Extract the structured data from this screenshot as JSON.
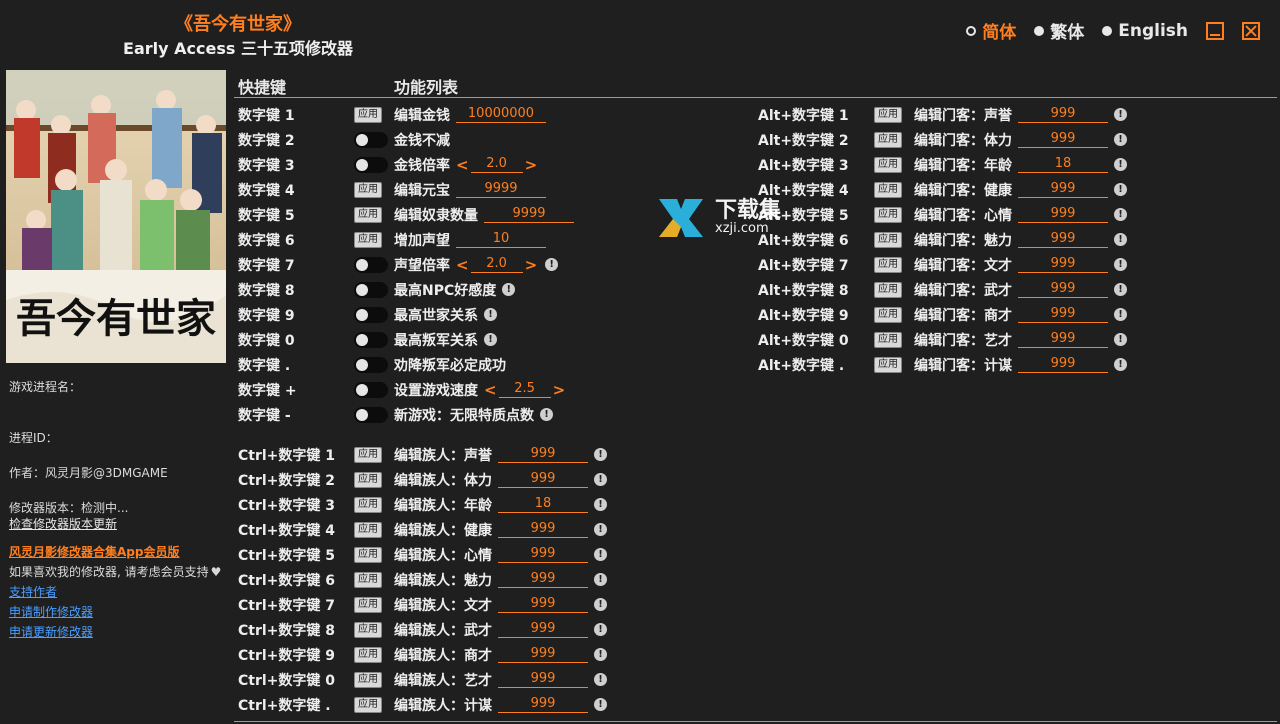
{
  "header": {
    "title": "《吾今有世家》",
    "subtitle": "Early Access 三十五项修改器",
    "languages": [
      "简体",
      "繁体",
      "English"
    ],
    "active_language": "简体"
  },
  "cover": {
    "calligraphy": "吾今有世家"
  },
  "left_panel": {
    "process_name_label": "游戏进程名：",
    "process_id_label": "进程ID：",
    "author": "作者：风灵月影@3DMGAME",
    "version": "修改器版本：检测中...",
    "check_update": "检查修改器版本更新",
    "app_link": "风灵月影修改器合集App会员版",
    "support_text": "如果喜欢我的修改器, 请考虑会员支持",
    "support_author": "支持作者",
    "request_make": "申请制作修改器",
    "request_update": "申请更新修改器"
  },
  "columns": {
    "hotkey": "快捷键",
    "features": "功能列表"
  },
  "apply_label": "应用",
  "info_symbol": "!",
  "arrow_left": "<",
  "arrow_right": ">",
  "watermark": {
    "line1": "下载集",
    "line2": "xzji.com"
  },
  "group1": [
    {
      "hotkey": "数字键 1",
      "type": "apply",
      "label": "编辑金钱",
      "value": "10000000",
      "info": false
    },
    {
      "hotkey": "数字键 2",
      "type": "toggle",
      "label": "金钱不减",
      "info": false
    },
    {
      "hotkey": "数字键 3",
      "type": "toggle",
      "label": "金钱倍率",
      "stepper": "2.0",
      "info": false
    },
    {
      "hotkey": "数字键 4",
      "type": "apply",
      "label": "编辑元宝",
      "value": "9999",
      "info": false
    },
    {
      "hotkey": "数字键 5",
      "type": "apply",
      "label": "编辑奴隶数量",
      "value": "9999",
      "info": false
    },
    {
      "hotkey": "数字键 6",
      "type": "apply",
      "label": "增加声望",
      "value": "10",
      "info": false
    },
    {
      "hotkey": "数字键 7",
      "type": "toggle",
      "label": "声望倍率",
      "stepper": "2.0",
      "info": true
    },
    {
      "hotkey": "数字键 8",
      "type": "toggle",
      "label": "最高NPC好感度",
      "info": true
    },
    {
      "hotkey": "数字键 9",
      "type": "toggle",
      "label": "最高世家关系",
      "info": true
    },
    {
      "hotkey": "数字键 0",
      "type": "toggle",
      "label": "最高叛军关系",
      "info": true
    },
    {
      "hotkey": "数字键 .",
      "type": "toggle",
      "label": "劝降叛军必定成功",
      "info": false
    },
    {
      "hotkey": "数字键 +",
      "type": "toggle",
      "label": "设置游戏速度",
      "stepper": "2.5",
      "info": false
    },
    {
      "hotkey": "数字键 -",
      "type": "toggle",
      "label": "新游戏：无限特质点数",
      "info": true
    }
  ],
  "group2": [
    {
      "hotkey": "Ctrl+数字键 1",
      "label": "编辑族人：声誉",
      "value": "999"
    },
    {
      "hotkey": "Ctrl+数字键 2",
      "label": "编辑族人：体力",
      "value": "999"
    },
    {
      "hotkey": "Ctrl+数字键 3",
      "label": "编辑族人：年龄",
      "value": "18"
    },
    {
      "hotkey": "Ctrl+数字键 4",
      "label": "编辑族人：健康",
      "value": "999"
    },
    {
      "hotkey": "Ctrl+数字键 5",
      "label": "编辑族人：心情",
      "value": "999"
    },
    {
      "hotkey": "Ctrl+数字键 6",
      "label": "编辑族人：魅力",
      "value": "999"
    },
    {
      "hotkey": "Ctrl+数字键 7",
      "label": "编辑族人：文才",
      "value": "999"
    },
    {
      "hotkey": "Ctrl+数字键 8",
      "label": "编辑族人：武才",
      "value": "999"
    },
    {
      "hotkey": "Ctrl+数字键 9",
      "label": "编辑族人：商才",
      "value": "999"
    },
    {
      "hotkey": "Ctrl+数字键 0",
      "label": "编辑族人：艺才",
      "value": "999"
    },
    {
      "hotkey": "Ctrl+数字键 .",
      "label": "编辑族人：计谋",
      "value": "999"
    }
  ],
  "group3": [
    {
      "hotkey": "Alt+数字键 1",
      "label": "编辑门客：声誉",
      "value": "999"
    },
    {
      "hotkey": "Alt+数字键 2",
      "label": "编辑门客：体力",
      "value": "999"
    },
    {
      "hotkey": "Alt+数字键 3",
      "label": "编辑门客：年龄",
      "value": "18"
    },
    {
      "hotkey": "Alt+数字键 4",
      "label": "编辑门客：健康",
      "value": "999"
    },
    {
      "hotkey": "Alt+数字键 5",
      "label": "编辑门客：心情",
      "value": "999"
    },
    {
      "hotkey": "Alt+数字键 6",
      "label": "编辑门客：魅力",
      "value": "999"
    },
    {
      "hotkey": "Alt+数字键 7",
      "label": "编辑门客：文才",
      "value": "999"
    },
    {
      "hotkey": "Alt+数字键 8",
      "label": "编辑门客：武才",
      "value": "999"
    },
    {
      "hotkey": "Alt+数字键 9",
      "label": "编辑门客：商才",
      "value": "999"
    },
    {
      "hotkey": "Alt+数字键 0",
      "label": "编辑门客：艺才",
      "value": "999"
    },
    {
      "hotkey": "Alt+数字键 .",
      "label": "编辑门客：计谋",
      "value": "999"
    }
  ]
}
